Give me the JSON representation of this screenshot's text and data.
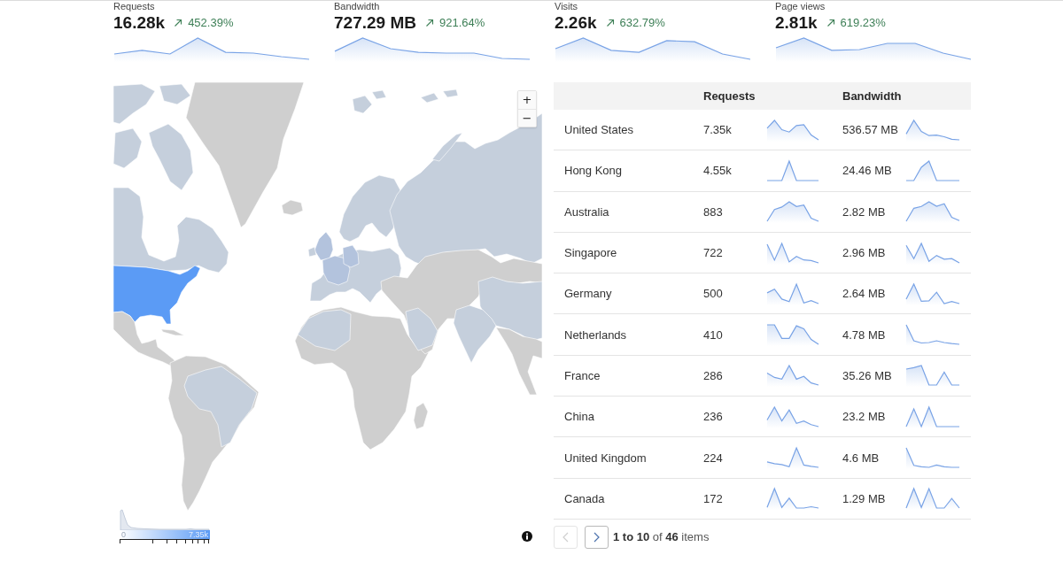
{
  "stats": [
    {
      "label": "Requests",
      "value": "16.28k",
      "change": "452.39%",
      "kind": "up"
    },
    {
      "label": "Bandwidth",
      "value": "727.29 MB",
      "change": "921.64%",
      "kind": "up"
    },
    {
      "label": "Visits",
      "value": "2.26k",
      "change": "632.79%",
      "kind": "up"
    },
    {
      "label": "Page views",
      "value": "2.81k",
      "change": "619.23%",
      "kind": "up"
    }
  ],
  "map": {
    "zoom_controls": [
      {
        "label": "+"
      },
      {
        "label": "−"
      }
    ],
    "legend": {
      "min": "0",
      "max": "7.35k"
    }
  },
  "table": {
    "columns": [
      "Requests",
      "Bandwidth"
    ],
    "rows": [
      {
        "country": "United States",
        "requests": "7.35k",
        "bandwidth": "536.57 MB"
      },
      {
        "country": "Hong Kong",
        "requests": "4.55k",
        "bandwidth": "24.46 MB"
      },
      {
        "country": "Australia",
        "requests": "883",
        "bandwidth": "2.82 MB"
      },
      {
        "country": "Singapore",
        "requests": "722",
        "bandwidth": "2.96 MB"
      },
      {
        "country": "Germany",
        "requests": "500",
        "bandwidth": "2.64 MB"
      },
      {
        "country": "Netherlands",
        "requests": "410",
        "bandwidth": "4.78 MB"
      },
      {
        "country": "France",
        "requests": "286",
        "bandwidth": "35.26 MB"
      },
      {
        "country": "China",
        "requests": "236",
        "bandwidth": "23.2 MB"
      },
      {
        "country": "United Kingdom",
        "requests": "224",
        "bandwidth": "4.6 MB"
      },
      {
        "country": "Canada",
        "requests": "172",
        "bandwidth": "1.29 MB"
      }
    ]
  },
  "pagination": {
    "previous": {
      "disabled": true
    },
    "next": {
      "disabled": false
    },
    "summary": "**1 to 10** of **46** items"
  }
}
